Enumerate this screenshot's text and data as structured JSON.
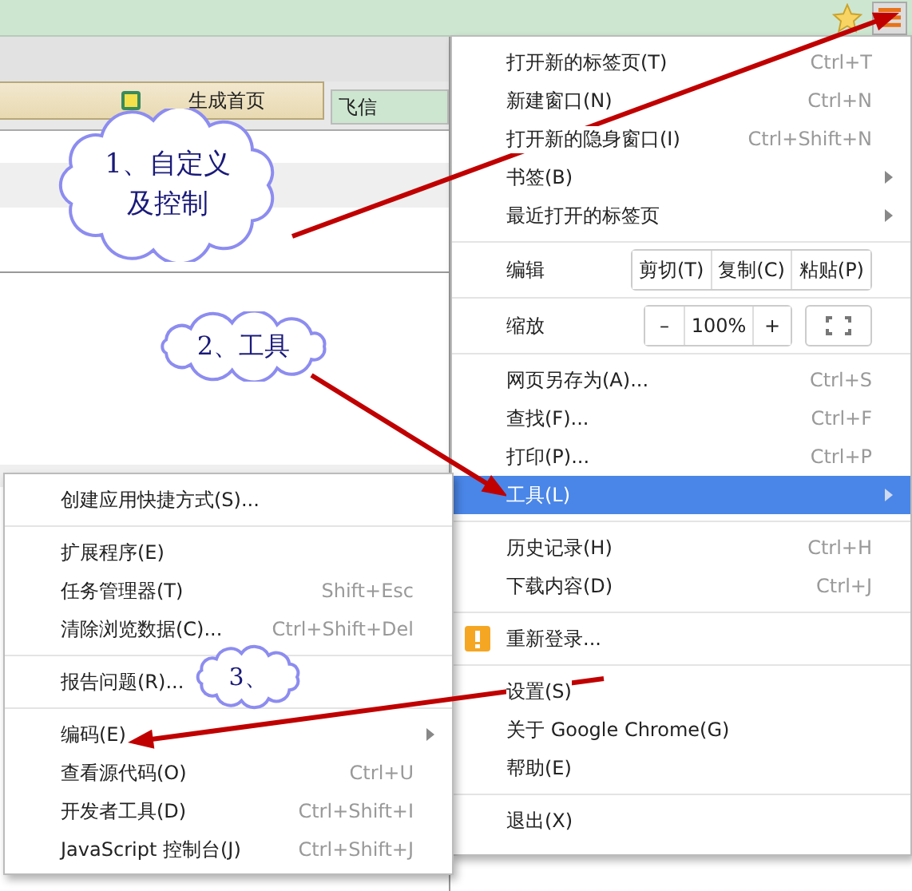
{
  "page": {
    "tab": {
      "label": "生成首页"
    },
    "field": {
      "value": "飞信"
    }
  },
  "main_menu": {
    "sections": [
      [
        {
          "kind": "item",
          "label": "打开新的标签页(T)",
          "shortcut": "Ctrl+T",
          "submenu": false,
          "selected": false
        },
        {
          "kind": "item",
          "label": "新建窗口(N)",
          "shortcut": "Ctrl+N",
          "submenu": false,
          "selected": false
        },
        {
          "kind": "item",
          "label": "打开新的隐身窗口(I)",
          "shortcut": "Ctrl+Shift+N",
          "submenu": false,
          "selected": false
        },
        {
          "kind": "item",
          "label": "书签(B)",
          "submenu": true,
          "selected": false
        },
        {
          "kind": "item",
          "label": "最近打开的标签页",
          "submenu": true,
          "selected": false
        }
      ],
      [
        {
          "kind": "edit",
          "label": "编辑",
          "buttons": [
            "剪切(T)",
            "复制(C)",
            "粘贴(P)"
          ]
        }
      ],
      [
        {
          "kind": "zoom",
          "label": "缩放",
          "minus": "–",
          "value": "100%",
          "plus": "+"
        }
      ],
      [
        {
          "kind": "item",
          "label": "网页另存为(A)...",
          "shortcut": "Ctrl+S",
          "submenu": false,
          "selected": false
        },
        {
          "kind": "item",
          "label": "查找(F)...",
          "shortcut": "Ctrl+F",
          "submenu": false,
          "selected": false
        },
        {
          "kind": "item",
          "label": "打印(P)...",
          "shortcut": "Ctrl+P",
          "submenu": false,
          "selected": false
        },
        {
          "kind": "item",
          "label": "工具(L)",
          "submenu": true,
          "selected": true
        }
      ],
      [
        {
          "kind": "item",
          "label": "历史记录(H)",
          "shortcut": "Ctrl+H",
          "submenu": false,
          "selected": false
        },
        {
          "kind": "item",
          "label": "下载内容(D)",
          "shortcut": "Ctrl+J",
          "submenu": false,
          "selected": false
        }
      ],
      [
        {
          "kind": "alert",
          "label": "重新登录...",
          "selected": false
        }
      ],
      [
        {
          "kind": "item",
          "label": "设置(S)",
          "submenu": false,
          "selected": false
        },
        {
          "kind": "item",
          "label": "关于 Google Chrome(G)",
          "submenu": false,
          "selected": false
        },
        {
          "kind": "item",
          "label": "帮助(E)",
          "submenu": false,
          "selected": false
        }
      ],
      [
        {
          "kind": "item",
          "label": "退出(X)",
          "submenu": false,
          "selected": false
        }
      ]
    ]
  },
  "tools_menu": {
    "sections": [
      [
        {
          "kind": "item",
          "label": "创建应用快捷方式(S)...",
          "submenu": false,
          "selected": false
        }
      ],
      [
        {
          "kind": "item",
          "label": "扩展程序(E)",
          "submenu": false,
          "selected": false
        },
        {
          "kind": "item",
          "label": "任务管理器(T)",
          "shortcut": "Shift+Esc",
          "submenu": false,
          "selected": false
        },
        {
          "kind": "item",
          "label": "清除浏览数据(C)...",
          "shortcut": "Ctrl+Shift+Del",
          "submenu": false,
          "selected": false
        }
      ],
      [
        {
          "kind": "item",
          "label": "报告问题(R)...",
          "submenu": false,
          "selected": false
        }
      ],
      [
        {
          "kind": "item",
          "label": "编码(E)",
          "submenu": true,
          "selected": false
        },
        {
          "kind": "item",
          "label": "查看源代码(O)",
          "shortcut": "Ctrl+U",
          "submenu": false,
          "selected": false
        },
        {
          "kind": "item",
          "label": "开发者工具(D)",
          "shortcut": "Ctrl+Shift+I",
          "submenu": false,
          "selected": false
        },
        {
          "kind": "item",
          "label": "JavaScript 控制台(J)",
          "shortcut": "Ctrl+Shift+J",
          "submenu": false,
          "selected": false
        }
      ]
    ]
  },
  "annotations": [
    {
      "text": "1、自定义及控制"
    },
    {
      "text": "2、工具"
    },
    {
      "text": "3、"
    }
  ]
}
